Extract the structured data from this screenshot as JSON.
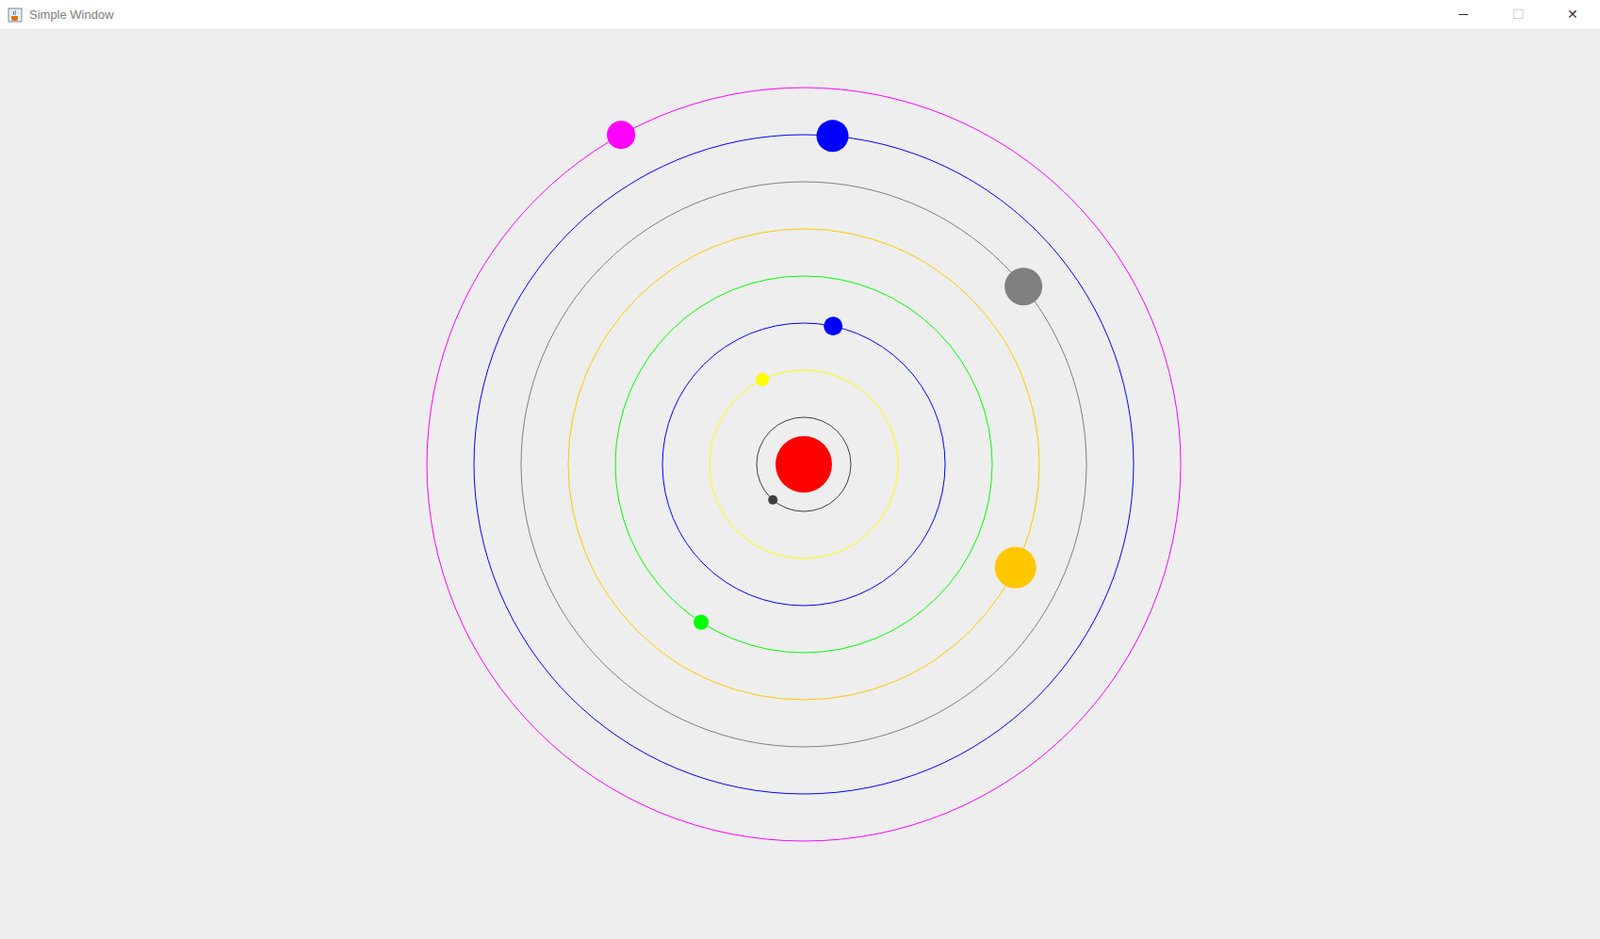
{
  "window": {
    "title": "Simple Window",
    "controls": [
      {
        "glyph": "─",
        "disabled": false
      },
      {
        "glyph": "☐",
        "disabled": true
      },
      {
        "glyph": "✕",
        "disabled": false
      }
    ]
  },
  "sun": {
    "color": "#ff0000"
  },
  "planets": [
    {
      "color": "#404040",
      "angle": 229
    },
    {
      "color": "#ffff00",
      "angle": 116
    },
    {
      "color": "#0000ff",
      "angle": 78
    },
    {
      "color": "#00ff00",
      "angle": 237
    },
    {
      "color": "#ffc800",
      "angle": 334
    },
    {
      "color": "#808080",
      "angle": 39
    },
    {
      "color": "#0000ff",
      "angle": 85
    },
    {
      "color": "#ff00ff",
      "angle": 119
    }
  ]
}
